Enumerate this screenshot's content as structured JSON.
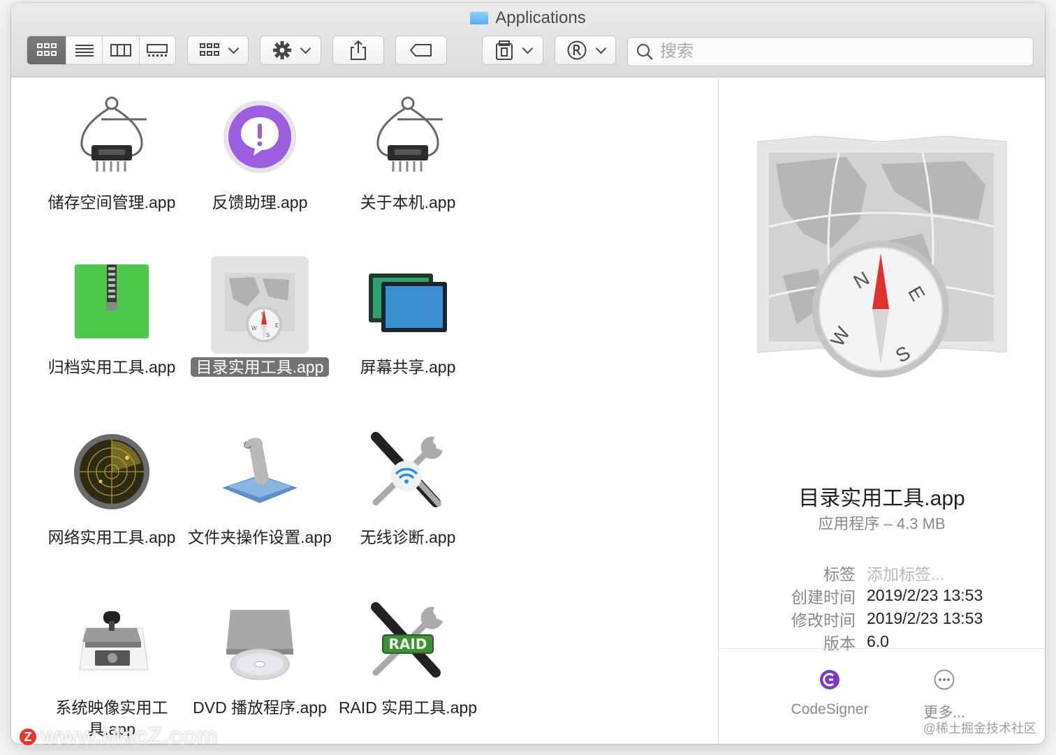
{
  "window": {
    "title": "Applications"
  },
  "toolbar": {
    "view_icon": "icon-view-button",
    "list_view": "list-view-button",
    "column_view": "column-view-button",
    "gallery_view": "gallery-view-button",
    "search_placeholder": "搜索"
  },
  "items": [
    {
      "label": "储存空间管理.app",
      "icon": "caliper-chip-icon"
    },
    {
      "label": "反馈助理.app",
      "icon": "feedback-icon"
    },
    {
      "label": "关于本机.app",
      "icon": "caliper-chip-icon"
    },
    {
      "label": "归档实用工具.app",
      "icon": "archive-zip-icon"
    },
    {
      "label": "目录实用工具.app",
      "icon": "directory-compass-icon",
      "selected": true
    },
    {
      "label": "屏幕共享.app",
      "icon": "screen-share-icon"
    },
    {
      "label": "网络实用工具.app",
      "icon": "radar-icon"
    },
    {
      "label": "文件夹操作设置.app",
      "icon": "folder-scroll-icon"
    },
    {
      "label": "无线诊断.app",
      "icon": "wireless-tools-icon"
    },
    {
      "label": "系统映像实用工具.app",
      "icon": "disk-image-icon"
    },
    {
      "label": "DVD 播放程序.app",
      "icon": "dvd-player-icon"
    },
    {
      "label": "RAID 实用工具.app",
      "icon": "raid-tools-icon"
    }
  ],
  "preview": {
    "name": "目录实用工具.app",
    "kind": "应用程序 – 4.3 MB",
    "meta": [
      {
        "key": "标签",
        "value": "添加标签...",
        "placeholder": true
      },
      {
        "key": "创建时间",
        "value": "2019/2/23 13:53"
      },
      {
        "key": "修改时间",
        "value": "2019/2/23 13:53"
      },
      {
        "key": "版本",
        "value": "6.0"
      }
    ],
    "actions": [
      {
        "label": "CodeSigner",
        "icon": "codesigner-icon"
      },
      {
        "label": "更多...",
        "icon": "more-icon"
      }
    ]
  },
  "watermark": {
    "text": "www.MacZ.com",
    "badge": "Z"
  },
  "credit": "@稀土掘金技术社区",
  "colors": {
    "selection": "#727272",
    "accent_red": "#e23b2e",
    "purple": "#8e59d6",
    "green": "#4cc94c"
  }
}
